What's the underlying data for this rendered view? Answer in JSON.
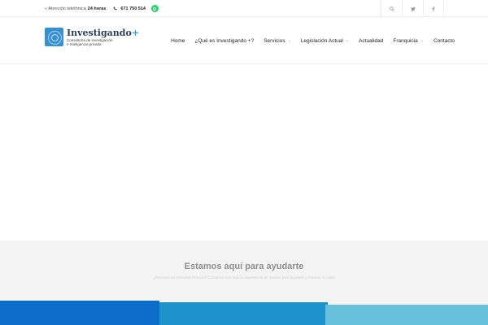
{
  "topbar": {
    "attention_text": "« Atención telefónica",
    "hours": "24 horas",
    "phone": "671 750 514",
    "icons": [
      "phone-icon",
      "whatsapp-icon",
      "search-icon",
      "twitter-icon",
      "facebook-icon"
    ]
  },
  "header": {
    "logo_title": "Investigando",
    "logo_plus": "+",
    "logo_sub1": "Consultoría de investigación",
    "logo_sub2": "e Inteligencia privada",
    "nav": [
      {
        "label": "Home"
      },
      {
        "label": "¿Qué es Investigando +?"
      },
      {
        "label": "Servicios"
      },
      {
        "label": "Legislación Actual"
      },
      {
        "label": "Actualidad"
      },
      {
        "label": "Franquicia"
      },
      {
        "label": "Contacto"
      }
    ],
    "dropdown_chevron": "⌄"
  },
  "help": {
    "title": "Estamos aquí para ayudarte",
    "subtitle": "¿Necesita un Detective Privado? Contamos con toda la experiencia en medios para ayudarle y resolver su caso"
  },
  "colors": {
    "block1": "#0b6ccc",
    "block2": "#1d93cc",
    "block3": "#66c0db",
    "whatsapp": "#25d366",
    "logo_accent": "#2aa0d8"
  }
}
